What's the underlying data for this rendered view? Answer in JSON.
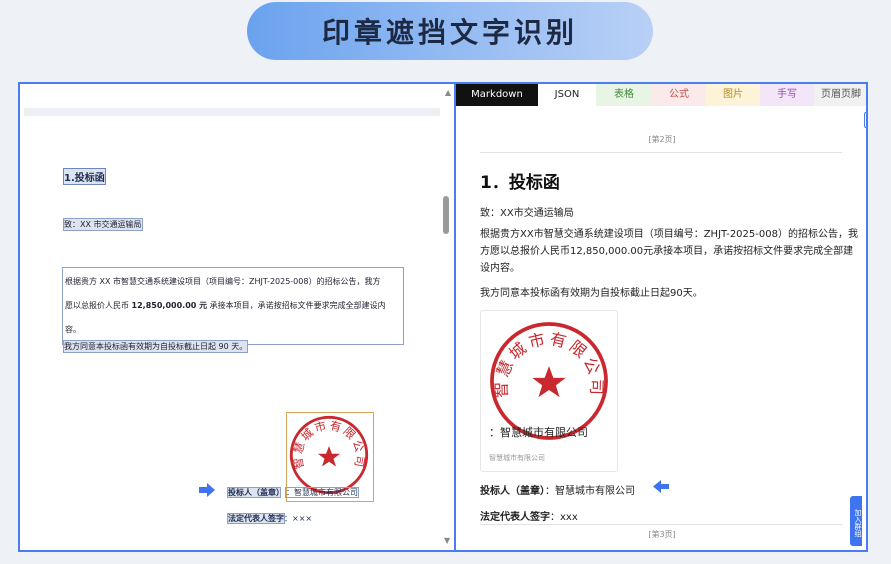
{
  "banner": {
    "title": "印章遮挡文字识别"
  },
  "left": {
    "title": "1.投标函",
    "to": "致：XX 市交通运输局",
    "para": {
      "line1": "根据贵方 XX 市智慧交通系统建设项目（项目编号：ZHJT-2025-008）的招标公告，我方",
      "line2_pre": "愿以总报价人民币 ",
      "line2_bold": "12,850,000.00 元",
      "line2_post": " 承接本项目，承诺按招标文件要求完成全部建设内",
      "line3": "容。"
    },
    "valid": "我方同意本投标函有效期为自投标截止日起 90 天。",
    "bidder_label": "投标人（盖章）",
    "bidder_value": "：智慧城市有限公司",
    "legal_label": "法定代表人签字",
    "legal_value": "：×××"
  },
  "seal": {
    "text": "智慧城市有限公司",
    "color": "#c8282e"
  },
  "right": {
    "tabs": [
      {
        "label": "Markdown"
      },
      {
        "label": "JSON"
      },
      {
        "label": "表格"
      },
      {
        "label": "公式"
      },
      {
        "label": "图片"
      },
      {
        "label": "手写"
      },
      {
        "label": "页眉页脚"
      }
    ],
    "page2": "[第2页]",
    "page3": "[第3页]",
    "title": "1．投标函",
    "to": "致：XX市交通运输局",
    "para": "根据贵方XX市智慧交通系统建设项目（项目编号：ZHJT-2025-008）的招标公告，我方愿以总报价人民币12,850,000.00元承接本项目，承诺按招标文件要求完成全部建设内容。",
    "valid": "我方同意本投标函有效期为自投标截止日起90天。",
    "card_text": "：智慧城市有限公司",
    "card_caption": "智慧城市有限公司",
    "bidder_label": "投标人（盖章）",
    "bidder_value": "：智慧城市有限公司",
    "legal_label": "法定代表人签字",
    "legal_value": "：xxx",
    "side_tab": "加入群组"
  },
  "colors": {
    "accent": "#4a7ef0",
    "stamp": "#c8282e"
  }
}
